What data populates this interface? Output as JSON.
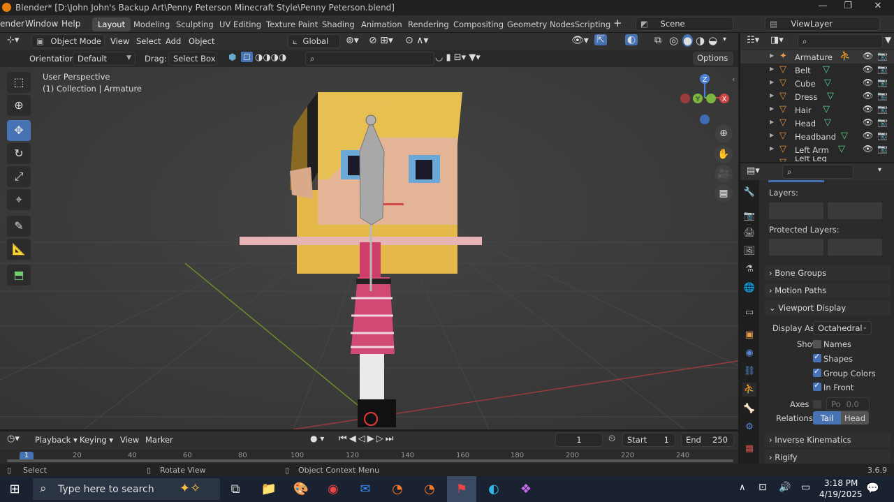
{
  "titlebar": {
    "title": "Blender* [D:\\John John's Backup Art\\Penny Peterson Minecraft Style\\Penny Peterson.blend]",
    "minimize": "—",
    "maximize": "❐",
    "close": "✕"
  },
  "menu": {
    "items": [
      "ender",
      "Window",
      "Help"
    ]
  },
  "workspaces": [
    "Layout",
    "Modeling",
    "Sculpting",
    "UV Editing",
    "Texture Paint",
    "Shading",
    "Animation",
    "Rendering",
    "Compositing",
    "Geometry Nodes",
    "Scripting"
  ],
  "scene": {
    "label": "Scene",
    "viewlayer": "ViewLayer"
  },
  "viewport_header": {
    "mode": "Object Mode",
    "menus": [
      "View",
      "Select",
      "Add",
      "Object"
    ],
    "transform": "Global"
  },
  "tool_settings": {
    "orientation_label": "Orientation:",
    "orientation_value": "Default",
    "drag_label": "Drag:",
    "drag_value": "Select Box",
    "options": "Options"
  },
  "overlay_text": {
    "perspective": "User Perspective",
    "collection": "(1) Collection | Armature"
  },
  "gizmo": {
    "z": "Z",
    "y": "Y",
    "x": "X"
  },
  "outliner": {
    "items": [
      {
        "name": "Armature",
        "icon": "armature-icon"
      },
      {
        "name": "Belt",
        "icon": "mesh-icon"
      },
      {
        "name": "Cube",
        "icon": "mesh-icon"
      },
      {
        "name": "Dress",
        "icon": "mesh-icon"
      },
      {
        "name": "Hair",
        "icon": "mesh-icon"
      },
      {
        "name": "Head",
        "icon": "mesh-icon"
      },
      {
        "name": "Headband",
        "icon": "mesh-icon"
      },
      {
        "name": "Left Arm",
        "icon": "mesh-icon"
      },
      {
        "name": "Left Leg",
        "icon": "mesh-icon"
      }
    ]
  },
  "properties": {
    "layers_label": "Layers:",
    "protected_layers_label": "Protected Layers:",
    "bone_groups": "Bone Groups",
    "motion_paths": "Motion Paths",
    "viewport_display": "Viewport Display",
    "display_as_label": "Display As",
    "display_as_value": "Octahedral",
    "show_label": "Show",
    "names": "Names",
    "shapes": "Shapes",
    "group_colors": "Group Colors",
    "in_front": "In Front",
    "axes_label": "Axes",
    "axes_po": "Po",
    "axes_value": "0.0",
    "relations_label": "Relations",
    "tail": "Tail",
    "head": "Head",
    "inverse_kinematics": "Inverse Kinematics",
    "rigify": "Rigify",
    "checks": {
      "names": false,
      "shapes": true,
      "group_colors": true,
      "in_front": true
    }
  },
  "timeline": {
    "menus": [
      "Playback",
      "Keying",
      "View",
      "Marker"
    ],
    "current_frame": "1",
    "start_label": "Start",
    "start": "1",
    "end_label": "End",
    "end": "250",
    "ticks": [
      "1",
      "20",
      "40",
      "60",
      "80",
      "100",
      "120",
      "140",
      "160",
      "180",
      "200",
      "220",
      "240"
    ]
  },
  "statusbar": {
    "select": "Select",
    "rotate": "Rotate View",
    "context": "Object Context Menu",
    "version": "3.6.9"
  },
  "taskbar": {
    "search_placeholder": "Type here to search",
    "time": "3:18 PM",
    "date": "4/19/2025"
  }
}
